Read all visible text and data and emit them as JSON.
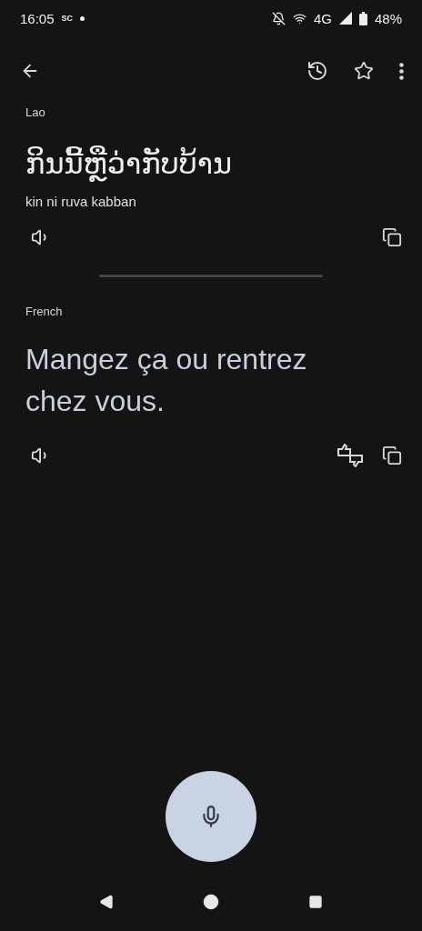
{
  "status_bar": {
    "time": "16:05",
    "carrier_tag": "SC",
    "network": "4G",
    "battery": "48%"
  },
  "source": {
    "language": "Lao",
    "text": "ກິນນີ້ຫຼືວ່າກັບບ້ານ",
    "transliteration": "kin ni ruva kabban"
  },
  "target": {
    "language": "French",
    "text": "Mangez ça ou rentrez chez vous."
  }
}
